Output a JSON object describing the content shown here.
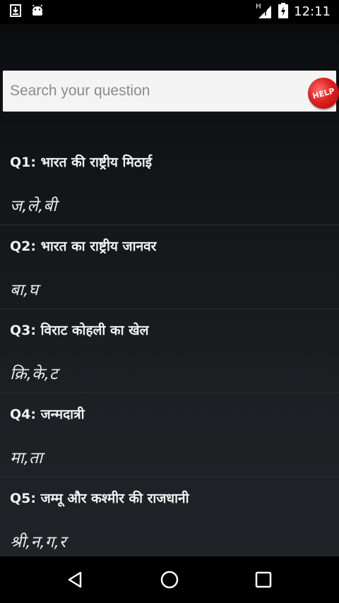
{
  "status_bar": {
    "time": "12:11",
    "network_label": "H"
  },
  "search": {
    "placeholder": "Search your question",
    "help_label": "HELP"
  },
  "questions": [
    {
      "question": "Q1: भारत की राष्ट्रीय मिठाई",
      "answer": "ज,ले,बी"
    },
    {
      "question": "Q2: भारत का राष्ट्रीय जानवर",
      "answer": "बा,घ"
    },
    {
      "question": "Q3: विराट कोहली का खेल",
      "answer": "क्रि,के,ट"
    },
    {
      "question": "Q4: जन्मदात्री",
      "answer": "मा,ता"
    },
    {
      "question": "Q5: जम्मू और कश्मीर की राजधानी",
      "answer": "श्री,न,ग,र"
    }
  ],
  "icons": {
    "download": "download-icon",
    "android": "android-icon",
    "signal": "signal-icon",
    "battery": "battery-charging-icon",
    "back": "back-icon",
    "home": "home-icon",
    "recents": "recents-icon"
  }
}
